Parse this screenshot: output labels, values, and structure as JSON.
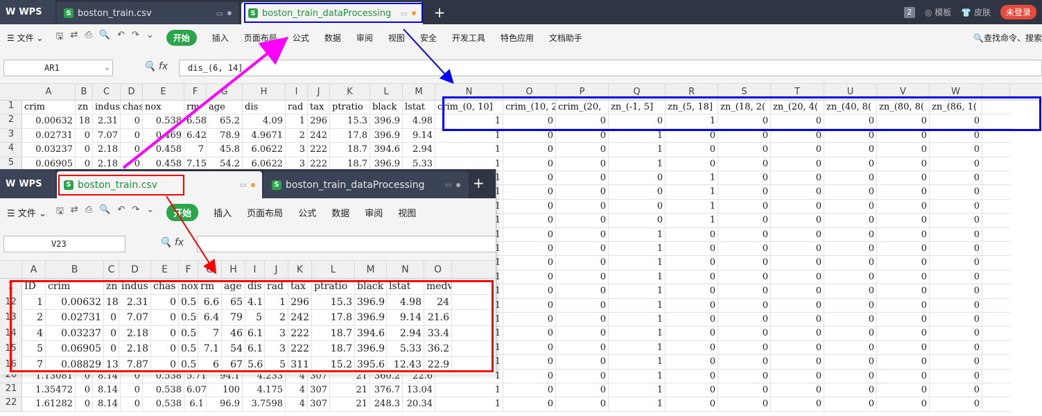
{
  "app": {
    "brand": "WPS"
  },
  "tabs": [
    {
      "label": "boston_train.csv"
    },
    {
      "label": "boston_train_dataProcessing"
    }
  ],
  "tabbar_right": {
    "badge": "2",
    "template": "模板",
    "skin": "皮肤",
    "login": "未登录"
  },
  "menu": {
    "file": "文件",
    "items": [
      "开始",
      "插入",
      "页面布局",
      "公式",
      "数据",
      "审阅",
      "视图",
      "安全",
      "开发工具",
      "特色应用",
      "文档助手"
    ],
    "search": "查找命令、搜索"
  },
  "formula": {
    "cell_ref": "AR1",
    "fx": "fx",
    "value": "dis_(6, 14]"
  },
  "main_sheet": {
    "columns": [
      "A",
      "B",
      "C",
      "D",
      "E",
      "F",
      "G",
      "H",
      "I",
      "J",
      "K",
      "L",
      "M",
      "N",
      "O",
      "P",
      "Q",
      "R",
      "S",
      "T",
      "U",
      "V",
      "W"
    ],
    "row_numbers": [
      "1",
      "2",
      "3",
      "4",
      "5",
      "",
      "",
      "",
      "",
      "",
      "",
      "",
      "",
      "",
      "",
      "",
      "",
      "",
      "",
      "20",
      "21",
      "22"
    ],
    "header_row": [
      "crim",
      "zn",
      "indus",
      "chas",
      "nox",
      "rm",
      "age",
      "dis",
      "rad",
      "tax",
      "ptratio",
      "black",
      "lstat",
      "crim_(0, 10]",
      "crim_(10, 20]",
      "crim_(20,",
      "zn_(-1, 5]",
      "zn_(5, 18]",
      "zn_(18, 2(",
      "zn_(20, 4(",
      "zn_(40, 8(",
      "zn_(80, 8(",
      "zn_(86, 1("
    ],
    "data_rows": [
      [
        "0.00632",
        "18",
        "2.31",
        "0",
        "0.538",
        "6.58",
        "65.2",
        "4.09",
        "1",
        "296",
        "15.3",
        "396.9",
        "4.98",
        "1",
        "0",
        "0",
        "0",
        "1",
        "0",
        "0",
        "0",
        "0",
        "0"
      ],
      [
        "0.02731",
        "0",
        "7.07",
        "0",
        "0.469",
        "6.42",
        "78.9",
        "4.9671",
        "2",
        "242",
        "17.8",
        "396.9",
        "9.14",
        "1",
        "0",
        "0",
        "1",
        "0",
        "0",
        "0",
        "0",
        "0",
        "0"
      ],
      [
        "0.03237",
        "0",
        "2.18",
        "0",
        "0.458",
        "7",
        "45.8",
        "6.0622",
        "3",
        "222",
        "18.7",
        "394.6",
        "2.94",
        "1",
        "0",
        "0",
        "1",
        "0",
        "0",
        "0",
        "0",
        "0",
        "0"
      ],
      [
        "0.06905",
        "0",
        "2.18",
        "0",
        "0.458",
        "7.15",
        "54.2",
        "6.0622",
        "3",
        "222",
        "18.7",
        "396.9",
        "5.33",
        "1",
        "0",
        "0",
        "1",
        "0",
        "0",
        "0",
        "0",
        "0",
        "0"
      ],
      [
        "",
        "",
        "",
        "",
        "",
        "",
        "",
        "",
        "",
        "",
        "",
        "",
        "",
        "1",
        "0",
        "0",
        "0",
        "1",
        "0",
        "0",
        "0",
        "0",
        "0"
      ],
      [
        "",
        "",
        "",
        "",
        "",
        "",
        "",
        "",
        "",
        "",
        "",
        "",
        "",
        "1",
        "0",
        "0",
        "0",
        "1",
        "0",
        "0",
        "0",
        "0",
        "0"
      ],
      [
        "",
        "",
        "",
        "",
        "",
        "",
        "",
        "",
        "",
        "",
        "",
        "",
        "",
        "1",
        "0",
        "0",
        "0",
        "1",
        "0",
        "0",
        "0",
        "0",
        "0"
      ],
      [
        "",
        "",
        "",
        "",
        "",
        "",
        "",
        "",
        "",
        "",
        "",
        "",
        "",
        "1",
        "0",
        "0",
        "0",
        "1",
        "0",
        "0",
        "0",
        "0",
        "0"
      ],
      [
        "",
        "",
        "",
        "",
        "",
        "",
        "",
        "",
        "",
        "",
        "",
        "",
        "",
        "1",
        "0",
        "0",
        "1",
        "0",
        "0",
        "0",
        "0",
        "0",
        "0"
      ],
      [
        "",
        "",
        "",
        "",
        "",
        "",
        "",
        "",
        "",
        "",
        "",
        "",
        "",
        "1",
        "0",
        "0",
        "1",
        "0",
        "0",
        "0",
        "0",
        "0",
        "0"
      ],
      [
        "",
        "",
        "",
        "",
        "",
        "",
        "",
        "",
        "",
        "",
        "",
        "",
        "",
        "1",
        "0",
        "0",
        "1",
        "0",
        "0",
        "0",
        "0",
        "0",
        "0"
      ],
      [
        "",
        "",
        "",
        "",
        "",
        "",
        "",
        "",
        "",
        "",
        "",
        "",
        "",
        "1",
        "0",
        "0",
        "1",
        "0",
        "0",
        "0",
        "0",
        "0",
        "0"
      ],
      [
        "",
        "",
        "",
        "",
        "",
        "",
        "",
        "",
        "",
        "",
        "",
        "",
        "",
        "1",
        "0",
        "0",
        "1",
        "0",
        "0",
        "0",
        "0",
        "0",
        "0"
      ],
      [
        "",
        "",
        "",
        "",
        "",
        "",
        "",
        "",
        "",
        "",
        "",
        "",
        "",
        "1",
        "0",
        "0",
        "1",
        "0",
        "0",
        "0",
        "0",
        "0",
        "0"
      ],
      [
        "",
        "",
        "",
        "",
        "",
        "",
        "",
        "",
        "",
        "",
        "",
        "",
        "",
        "1",
        "0",
        "0",
        "1",
        "0",
        "0",
        "0",
        "0",
        "0",
        "0"
      ],
      [
        "",
        "",
        "",
        "",
        "",
        "",
        "",
        "",
        "",
        "",
        "",
        "",
        "",
        "1",
        "0",
        "0",
        "1",
        "0",
        "0",
        "0",
        "0",
        "0",
        "0"
      ],
      [
        "",
        "",
        "",
        "",
        "",
        "",
        "",
        "",
        "",
        "",
        "",
        "",
        "",
        "1",
        "0",
        "0",
        "1",
        "0",
        "0",
        "0",
        "0",
        "0",
        "0"
      ],
      [
        "",
        "",
        "",
        "",
        "",
        "",
        "",
        "",
        "",
        "",
        "",
        "",
        "",
        "1",
        "0",
        "0",
        "1",
        "0",
        "0",
        "0",
        "0",
        "0",
        "0"
      ],
      [
        "1.13081",
        "0",
        "8.14",
        "0",
        "0.538",
        "5.71",
        "94.1",
        "4.233",
        "4",
        "307",
        "21",
        "360.2",
        "22.6",
        "1",
        "0",
        "0",
        "1",
        "0",
        "0",
        "0",
        "0",
        "0",
        "0"
      ],
      [
        "1.35472",
        "0",
        "8.14",
        "0",
        "0.538",
        "6.07",
        "100",
        "4.175",
        "4",
        "307",
        "21",
        "376.7",
        "13.04",
        "1",
        "0",
        "0",
        "1",
        "0",
        "0",
        "0",
        "0",
        "0",
        "0"
      ],
      [
        "1.61282",
        "0",
        "8.14",
        "0",
        "0.538",
        "6.1",
        "96.9",
        "3.7598",
        "4",
        "307",
        "21",
        "248.3",
        "20.34",
        "1",
        "0",
        "0",
        "1",
        "0",
        "0",
        "0",
        "0",
        "0",
        "0"
      ]
    ]
  },
  "overlay_window": {
    "brand": "WPS",
    "tabs": [
      {
        "label": "boston_train.csv"
      },
      {
        "label": "boston_train_dataProcessing"
      }
    ],
    "menu": {
      "file": "文件",
      "items": [
        "开始",
        "插入",
        "页面布局",
        "公式",
        "数据",
        "审阅",
        "视图"
      ]
    },
    "formula": {
      "cell_ref": "V23",
      "fx": "fx"
    },
    "columns": [
      "A",
      "B",
      "C",
      "D",
      "E",
      "F",
      "G",
      "H",
      "I",
      "J",
      "K",
      "L",
      "M",
      "N",
      "O"
    ],
    "row_numbers": [
      "1",
      "12",
      "13",
      "14",
      "15",
      "16"
    ],
    "header_row": [
      "ID",
      "crim",
      "zn",
      "indus",
      "chas",
      "nox",
      "rm",
      "age",
      "dis",
      "rad",
      "tax",
      "ptratio",
      "black",
      "lstat",
      "medv"
    ],
    "data_rows": [
      [
        "1",
        "0.00632",
        "18",
        "2.31",
        "0",
        "0.5",
        "6.6",
        "65",
        "4.1",
        "1",
        "296",
        "15.3",
        "396.9",
        "4.98",
        "24"
      ],
      [
        "2",
        "0.02731",
        "0",
        "7.07",
        "0",
        "0.5",
        "6.4",
        "79",
        "5",
        "2",
        "242",
        "17.8",
        "396.9",
        "9.14",
        "21.6"
      ],
      [
        "4",
        "0.03237",
        "0",
        "2.18",
        "0",
        "0.5",
        "7",
        "46",
        "6.1",
        "3",
        "222",
        "18.7",
        "394.6",
        "2.94",
        "33.4"
      ],
      [
        "5",
        "0.06905",
        "0",
        "2.18",
        "0",
        "0.5",
        "7.1",
        "54",
        "6.1",
        "3",
        "222",
        "18.7",
        "396.9",
        "5.33",
        "36.2"
      ],
      [
        "7",
        "0.08829",
        "13",
        "7.87",
        "0",
        "0.5",
        "6",
        "67",
        "5.6",
        "5",
        "311",
        "15.2",
        "395.6",
        "12.43",
        "22.9"
      ]
    ]
  },
  "annotation_colors": {
    "magenta": "#ff00ff",
    "blue": "#0000ff",
    "red": "#ff0000"
  }
}
